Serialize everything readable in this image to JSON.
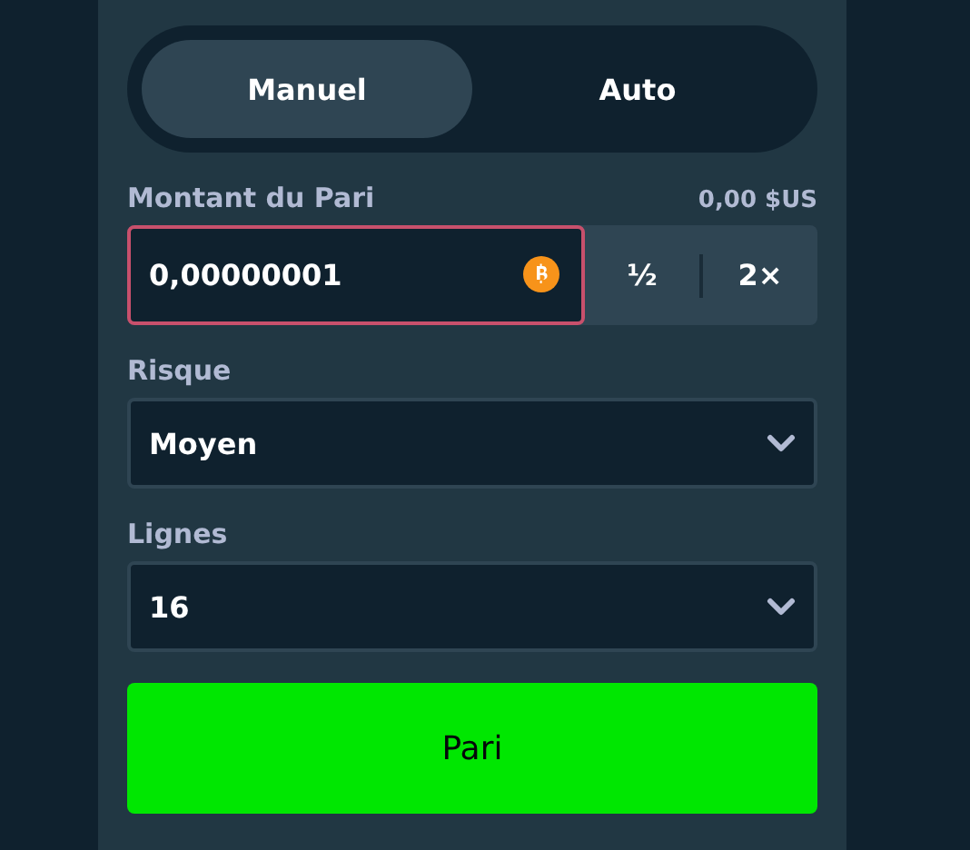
{
  "mode_tabs": [
    {
      "label": "Manuel",
      "selected": true
    },
    {
      "label": "Auto",
      "selected": false
    }
  ],
  "bet_amount": {
    "label": "Montant du Pari",
    "usd_value": "0,00 $US",
    "value": "0,00000001",
    "error": true,
    "actions": [
      "½",
      "2×"
    ]
  },
  "risk": {
    "label": "Risque",
    "value": "Moyen"
  },
  "rows": {
    "label": "Lignes",
    "value": "16"
  },
  "bet_button": "Pari"
}
